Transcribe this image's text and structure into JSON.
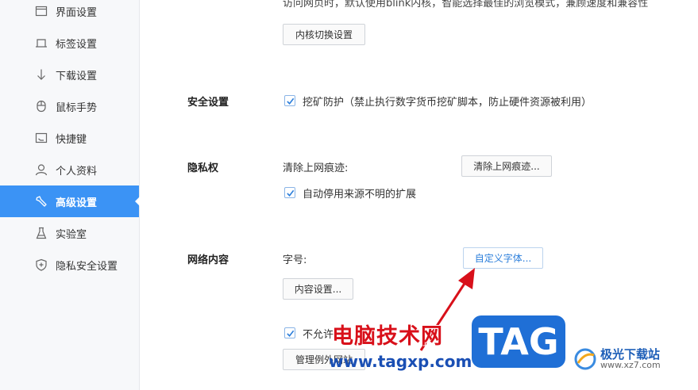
{
  "sidebar": {
    "items": [
      {
        "label": "界面设置",
        "icon": "window-icon",
        "active": false
      },
      {
        "label": "标签设置",
        "icon": "tab-icon",
        "active": false
      },
      {
        "label": "下载设置",
        "icon": "download-arrow-icon",
        "active": false
      },
      {
        "label": "鼠标手势",
        "icon": "mouse-icon",
        "active": false
      },
      {
        "label": "快捷键",
        "icon": "shortcut-key-icon",
        "active": false
      },
      {
        "label": "个人资料",
        "icon": "person-icon",
        "active": false
      },
      {
        "label": "高级设置",
        "icon": "wrench-icon",
        "active": true
      },
      {
        "label": "实验室",
        "icon": "flask-icon",
        "active": false
      },
      {
        "label": "隐私安全设置",
        "icon": "shield-icon",
        "active": false
      }
    ]
  },
  "kernel": {
    "description": "访问网页时，默认使用blink内核，智能选择最佳的浏览模式，兼顾速度和兼容性",
    "switch_button": "内核切换设置"
  },
  "security": {
    "title": "安全设置",
    "mining_protection": "挖矿防护（禁止执行数字货币挖矿脚本，防止硬件资源被利用）",
    "mining_checked": true
  },
  "privacy": {
    "title": "隐私权",
    "clear_label": "清除上网痕迹:",
    "clear_button": "清除上网痕迹...",
    "disable_unknown_ext": "自动停用来源不明的扩展",
    "disable_checked": true
  },
  "web_content": {
    "title": "网络内容",
    "font_label": "字号:",
    "custom_font_button": "自定义字体...",
    "content_settings_button": "内容设置...",
    "disallow_label": "不允许",
    "disallow_checked": true,
    "manage_exceptions_button": "管理例外网站"
  },
  "watermark": {
    "site_name": "电脑技术网",
    "site_url": "www.tagxp.com",
    "badge": "TAG",
    "logo_name": "极光下载站",
    "logo_url": "www.xz7.com"
  },
  "colors": {
    "accent": "#3b93f5",
    "link_button": "#2d7fdb",
    "arrow": "#d8101a"
  }
}
